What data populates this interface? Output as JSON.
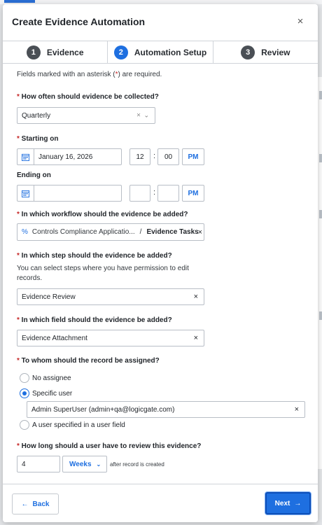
{
  "modal": {
    "title": "Create Evidence Automation",
    "close_symbol": "×"
  },
  "steps": [
    {
      "num": "1",
      "label": "Evidence"
    },
    {
      "num": "2",
      "label": "Automation Setup"
    },
    {
      "num": "3",
      "label": "Review"
    }
  ],
  "form": {
    "required_note_pre": "Fields marked with an asterisk (",
    "required_note_ast": "*",
    "required_note_post": ") are required.",
    "frequency": {
      "label": "How often should evidence be collected?",
      "value": "Quarterly"
    },
    "starting": {
      "label": "Starting on",
      "date": "January 16, 2026",
      "hour": "12",
      "minute": "00",
      "ampm": "PM"
    },
    "ending": {
      "label": "Ending on",
      "date": "",
      "hour": "",
      "minute": "",
      "ampm": "PM"
    },
    "workflow": {
      "label": "In which workflow should the evidence be added?",
      "app_name": "Controls Compliance Applicatio...",
      "separator": "/",
      "workflow_name": "Evidence Tasks"
    },
    "step": {
      "label": "In which step should the evidence be added?",
      "help": "You can select steps where you have permission to edit records.",
      "value": "Evidence Review"
    },
    "field": {
      "label": "In which field should the evidence be added?",
      "value": "Evidence Attachment"
    },
    "assignee": {
      "label": "To whom should the record be assigned?",
      "options": [
        "No assignee",
        "Specific user",
        "A user specified in a user field"
      ],
      "selected_user": "Admin SuperUser (admin+qa@logicgate.com)"
    },
    "review": {
      "label": "How long should a user have to review this evidence?",
      "amount": "4",
      "unit": "Weeks",
      "after_text": "after record is created"
    },
    "colon": ":"
  },
  "footer": {
    "back_label": "Back",
    "next_label": "Next"
  },
  "colors": {
    "accent": "#1e6fe0",
    "required": "#c62828"
  }
}
